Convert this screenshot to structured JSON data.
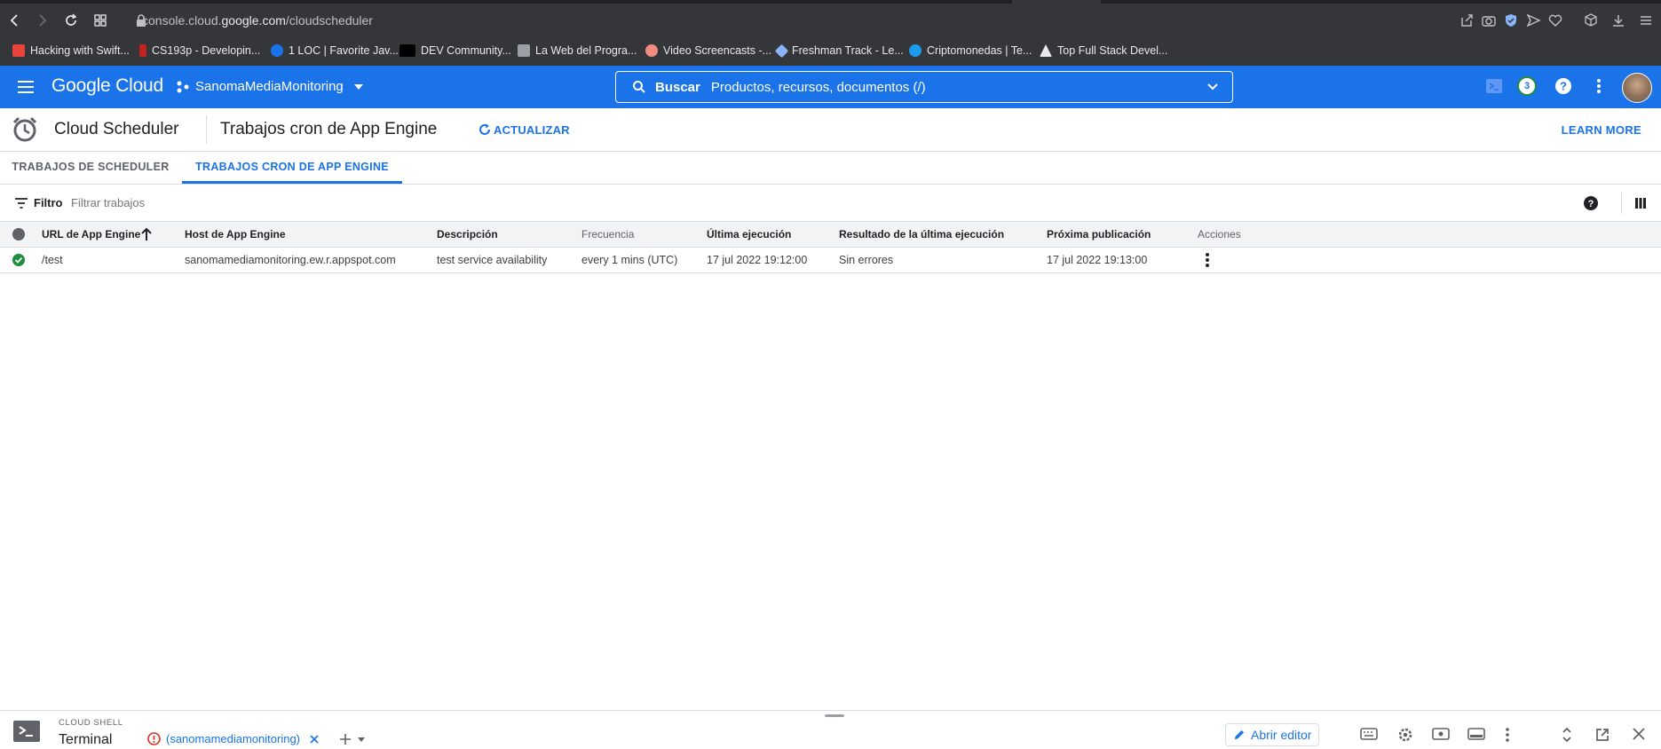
{
  "browser": {
    "url_host_pre": "console.cloud.",
    "url_host_main": "google.com",
    "url_path": "/cloudscheduler",
    "bookmarks": [
      {
        "label": "Hacking with Swift..."
      },
      {
        "label": "CS193p - Developin..."
      },
      {
        "label": "1 LOC | Favorite Jav..."
      },
      {
        "label": "DEV Community..."
      },
      {
        "label": "La Web del Progra..."
      },
      {
        "label": "Video Screencasts -..."
      },
      {
        "label": "Freshman Track - Le..."
      },
      {
        "label": "Criptomonedas | Te..."
      },
      {
        "label": "Top Full Stack Devel..."
      }
    ]
  },
  "header": {
    "logo": "Google Cloud",
    "project": "SanomaMediaMonitoring",
    "search_label": "Buscar",
    "search_placeholder": "Productos, recursos, documentos (/)",
    "notification_count": "3"
  },
  "page": {
    "product": "Cloud Scheduler",
    "title": "Trabajos cron de App Engine",
    "refresh": "ACTUALIZAR",
    "learn_more": "LEARN MORE"
  },
  "tabs": [
    {
      "label": "TRABAJOS DE SCHEDULER"
    },
    {
      "label": "TRABAJOS CRON DE APP ENGINE"
    }
  ],
  "filter": {
    "label": "Filtro",
    "placeholder": "Filtrar trabajos"
  },
  "table": {
    "columns": [
      "URL de App Engine",
      "Host de App Engine",
      "Descripción",
      "Frecuencia",
      "Última ejecución",
      "Resultado de la última ejecución",
      "Próxima publicación",
      "Acciones"
    ],
    "rows": [
      {
        "url": "/test",
        "host": "sanomamediamonitoring.ew.r.appspot.com",
        "description": "test service availability",
        "frequency": "every 1 mins (UTC)",
        "last_run": "17 jul 2022 19:12:00",
        "result": "Sin errores",
        "next": "17 jul 2022 19:13:00"
      }
    ]
  },
  "shell": {
    "caption": "CLOUD SHELL",
    "terminal": "Terminal",
    "tab_label": "(sanomamediamonitoring)",
    "editor_button": "Abrir editor"
  },
  "colors": {
    "brand_blue": "#1a73e8",
    "success_green": "#1e8e3e",
    "error_red": "#d93025"
  }
}
